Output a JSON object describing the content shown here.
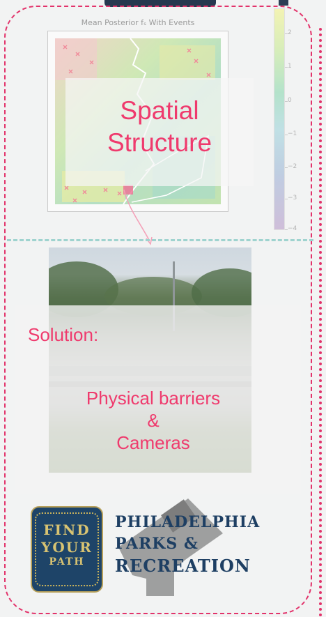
{
  "map": {
    "title": "Mean Posterior fₛ With Events",
    "colorbar_ticks": [
      "2",
      "1",
      "0",
      "−1",
      "−2",
      "−3",
      "−4"
    ]
  },
  "overlay": {
    "spatial_label_line1": "Spatial",
    "spatial_label_line2": "Structure"
  },
  "solution": {
    "title": "Solution:",
    "line1": "Physical barriers",
    "line2": "&",
    "line3": "Cameras"
  },
  "logo": {
    "badge_line1": "FIND",
    "badge_line2": "YOUR",
    "badge_line3": "PATH",
    "org_line1": "PHILADELPHIA",
    "org_line2": "PARKS &",
    "org_line3": "RECREATION"
  },
  "colors": {
    "accent": "#ef3a6d",
    "border": "#e2336b",
    "divider": "#9fd3cf",
    "logo_navy": "#1e3f63",
    "logo_gold": "#c8b25c"
  }
}
